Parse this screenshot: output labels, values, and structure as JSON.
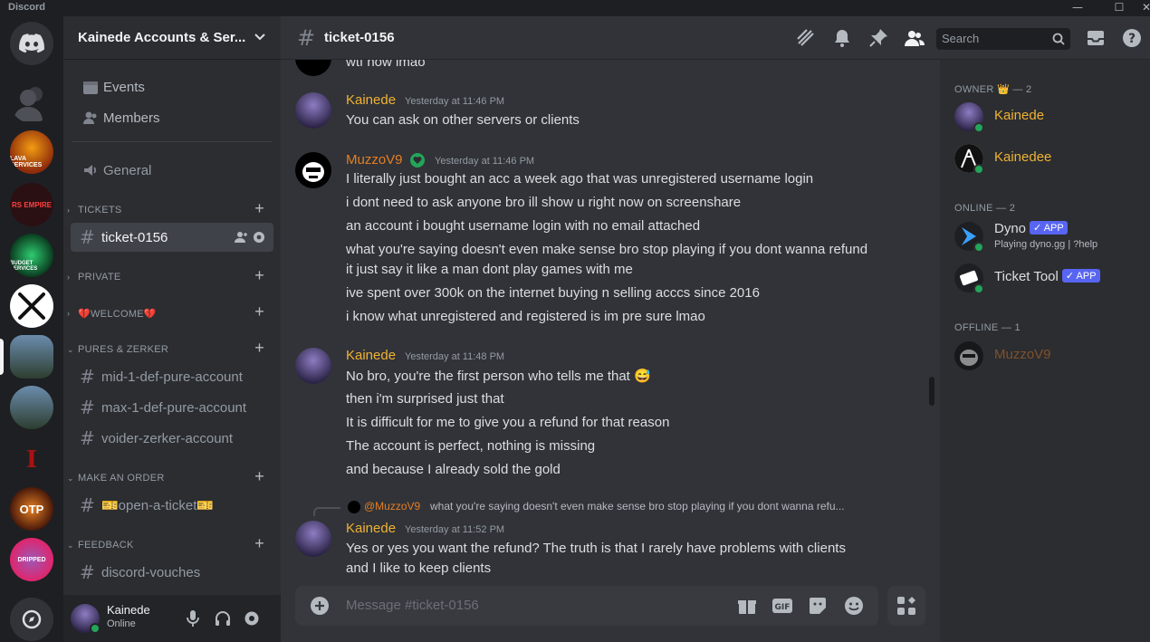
{
  "titlebar": {
    "brand": "Discord"
  },
  "server": {
    "name": "Kainede Accounts & Ser...",
    "events_label": "Events",
    "members_label": "Members",
    "general_label": "General",
    "categories": [
      {
        "name": "TICKETS",
        "channels": [
          "ticket-0156"
        ]
      },
      {
        "name": "PRIVATE",
        "channels": []
      },
      {
        "name": "💔WELCOME💔",
        "channels": []
      },
      {
        "name": "PURES & ZERKER",
        "channels": [
          "mid-1-def-pure-account",
          "max-1-def-pure-account",
          "voider-zerker-account"
        ]
      },
      {
        "name": "MAKE AN ORDER",
        "channels": [
          "🎫open-a-ticket🎫"
        ]
      },
      {
        "name": "FEEDBACK",
        "channels": [
          "discord-vouches"
        ]
      }
    ],
    "icons": [
      "LAVA SERVICES",
      "RS EMPIRE",
      "BUDGET SERVICES",
      "",
      "",
      "",
      "",
      "OTP",
      "DRIPPED"
    ]
  },
  "user_panel": {
    "name": "Kainede",
    "status": "Online"
  },
  "channel": {
    "name": "ticket-0156",
    "search_placeholder": "Search",
    "composer_placeholder": "Message #ticket-0156"
  },
  "messages": {
    "top_fragment": "wtf how lmao",
    "m1": {
      "author": "Kainede",
      "time": "Yesterday at 11:46 PM",
      "lines": [
        "You can ask on other servers or clients"
      ]
    },
    "m2": {
      "author": "MuzzoV9",
      "time": "Yesterday at 11:46 PM",
      "lines": [
        "I literally just bought an acc a week ago that was unregistered username login",
        "i dont need to ask anyone bro ill show u right now on screenshare",
        "an account i bought username login with no email attached",
        "what you're saying doesn't even make sense bro stop playing if you dont wanna refund",
        "it just say it like a man dont play games with me",
        "ive spent over 300k on the internet buying n selling acccs since 2016",
        "i know what unregistered and registered is im pre sure lmao"
      ]
    },
    "m3": {
      "author": "Kainede",
      "time": "Yesterday at 11:48 PM",
      "lines": [
        "No bro, you're the first person who tells me that 😅",
        "then i'm surprised just that",
        "It is difficult for me to give you a refund for that reason",
        "The account is perfect, nothing is missing",
        "and because I already sold the gold"
      ]
    },
    "m4": {
      "reply_author": "@MuzzoV9",
      "reply_text": "what you're saying doesn't even make sense bro stop playing if you dont wanna refu...",
      "author": "Kainede",
      "time": "Yesterday at 11:52 PM",
      "lines": [
        "Yes or yes you want the refund? The truth is that I rarely have problems with clients",
        "and I like to keep clients"
      ]
    }
  },
  "member_list": {
    "owner_header": "OWNER 👑 — 2",
    "owners": [
      "Kainede",
      "Kainedee"
    ],
    "online_header": "ONLINE — 2",
    "online": [
      {
        "name": "Dyno",
        "badge": "✓ APP",
        "activity": "Playing dyno.gg | ?help"
      },
      {
        "name": "Ticket Tool",
        "badge": "✓ APP",
        "activity": ""
      }
    ],
    "offline_header": "OFFLINE — 1",
    "offline": [
      "MuzzoV9"
    ]
  },
  "colors": {
    "owner": "#f0b232",
    "muzzo": "#e67e22",
    "online_dot": "#23a55a",
    "blurple": "#5865f2"
  }
}
